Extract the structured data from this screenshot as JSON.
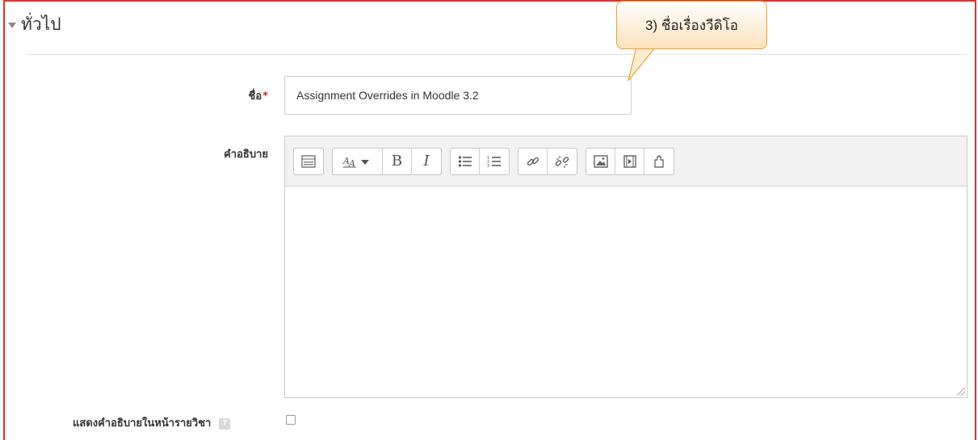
{
  "section": {
    "title": "ทั่วไป",
    "collapse_icon": "chevron-down-icon"
  },
  "fields": {
    "name_label": "ชื่อ",
    "name_required": "*",
    "name_value": "Assignment Overrides in Moodle 3.2",
    "description_label": "คำอธิบาย",
    "show_description_label": "แสดงคำอธิบายในหน้ารายวิชา",
    "help_icon_text": "?",
    "show_description_checked": false
  },
  "toolbar": {
    "groups": [
      [
        "toggle-toolbar-icon"
      ],
      [
        "font-style-icon",
        "bold-icon",
        "italic-icon"
      ],
      [
        "unordered-list-icon",
        "ordered-list-icon"
      ],
      [
        "link-icon",
        "unlink-icon"
      ],
      [
        "image-icon",
        "media-icon",
        "manage-files-icon"
      ]
    ],
    "bold_glyph": "B",
    "italic_glyph": "I"
  },
  "callout": {
    "text": "3) ชื่อเรื่องวีดิโอ"
  },
  "colors": {
    "frame_border": "#e62e2e",
    "callout_border": "#f0a030",
    "required": "#c9302c"
  }
}
